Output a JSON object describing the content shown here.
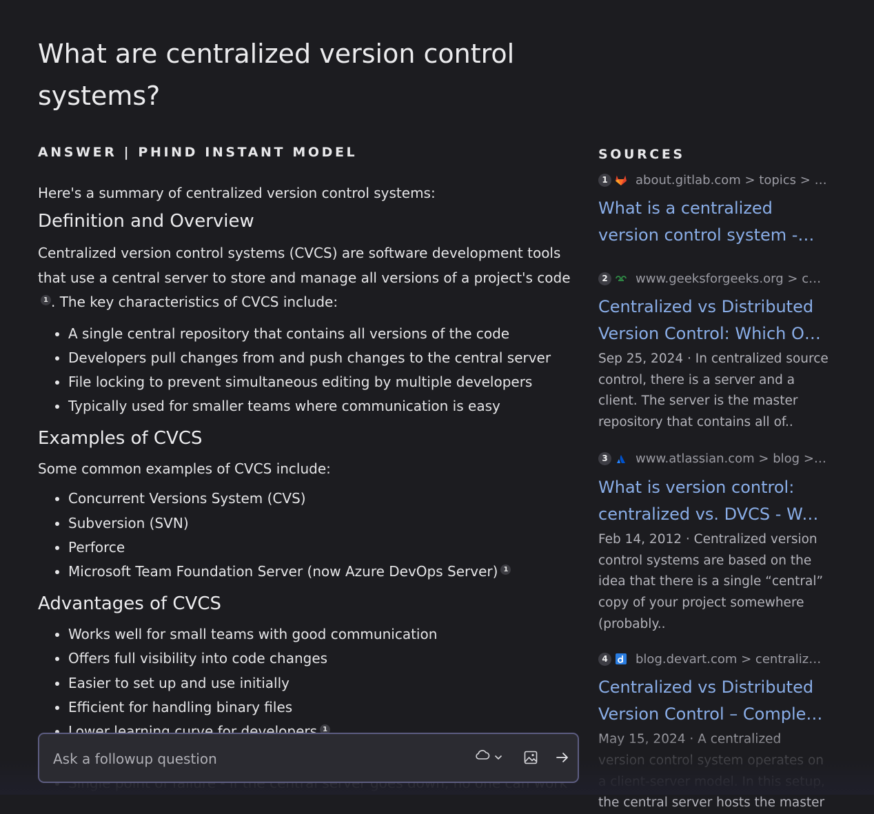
{
  "question": "What are centralized version control systems?",
  "answer": {
    "label": "ANSWER | PHIND INSTANT MODEL",
    "intro": "Here's a summary of centralized version control systems:",
    "definition": {
      "heading": "Definition and Overview",
      "text_before_cite": "Centralized version control systems (CVCS) are software development tools that use a central server to store and manage all versions of a project's code",
      "cite": "1",
      "text_after_cite": ". The key characteristics of CVCS include:",
      "bullets": [
        "A single central repository that contains all versions of the code",
        "Developers pull changes from and push changes to the central server",
        "File locking to prevent simultaneous editing by multiple developers",
        "Typically used for smaller teams where communication is easy"
      ]
    },
    "examples": {
      "heading": "Examples of CVCS",
      "intro": "Some common examples of CVCS include:",
      "bullets": [
        "Concurrent Versions System (CVS)",
        "Subversion (SVN)",
        "Perforce",
        "Microsoft Team Foundation Server (now Azure DevOps Server)"
      ],
      "last_cite": "1"
    },
    "advantages": {
      "heading": "Advantages of CVCS",
      "bullets": [
        "Works well for small teams with good communication",
        "Offers full visibility into code changes",
        "Easier to set up and use initially",
        "Efficient for handling binary files",
        "Lower learning curve for developers"
      ],
      "last_cite": "1",
      "partial_next": "Single point of failure - if the central server goes down, no one can work"
    }
  },
  "sources": {
    "label": "SOURCES",
    "items": [
      {
        "num": "1",
        "icon": "gitlab-icon",
        "meta": "about.gitlab.com > topics > version-control",
        "title": "What is a centralized version control system - GitLab",
        "snippet": ""
      },
      {
        "num": "2",
        "icon": "geeksforgeeks-icon",
        "meta": "www.geeksforgeeks.org > centralized-vs-distributed",
        "title": "Centralized vs Distributed Version Control: Which One Should We Choose?",
        "snippet": "Sep 25, 2024 · In centralized source control, there is a server and a client. The server is the master repository that contains all of.."
      },
      {
        "num": "3",
        "icon": "atlassian-icon",
        "meta": "www.atlassian.com > blog > software-teams",
        "title": "What is version control: centralized vs. DVCS - Work Life by Atlassian",
        "snippet": "Feb 14, 2012 · Centralized version control systems are based on the idea that there is a single “central” copy of your project somewhere (probably.."
      },
      {
        "num": "4",
        "icon": "devart-icon",
        "meta": "blog.devart.com > centralized-vs-distributed",
        "title": "Centralized vs Distributed Version Control – Complete Guide",
        "snippet": "May 15, 2024 · A centralized version control system operates on a client-server model. In this setup, the central server hosts the master"
      }
    ]
  },
  "input": {
    "placeholder": "Ask a followup question"
  },
  "colors": {
    "background": "#1c1c20",
    "link": "#8aaee8",
    "input_border": "#5d5d82"
  }
}
